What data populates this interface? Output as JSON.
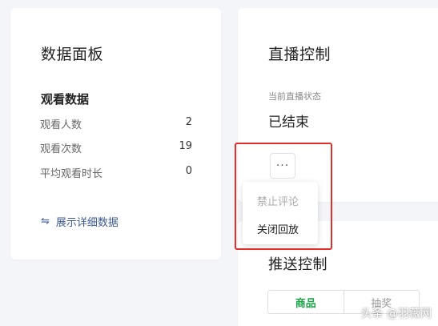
{
  "data_panel": {
    "title": "数据面板",
    "section_title": "观看数据",
    "rows": [
      {
        "label": "观看人数",
        "value": "2"
      },
      {
        "label": "观看次数",
        "value": "19"
      },
      {
        "label": "平均观看时长",
        "value": "0"
      }
    ],
    "expand_link": "展示详细数据"
  },
  "live_control": {
    "title": "直播控制",
    "status_label": "当前直播状态",
    "status_value": "已结束",
    "more_button": "···"
  },
  "dropdown_menu": {
    "items": [
      {
        "label": "禁止评论",
        "disabled": true
      },
      {
        "label": "关闭回放",
        "disabled": false
      }
    ]
  },
  "push_control": {
    "title": "推送控制",
    "tabs": [
      {
        "label": "商品",
        "active": true
      },
      {
        "label": "抽奖",
        "active": false
      }
    ]
  },
  "watermark": "头条 @羽薇网",
  "colors": {
    "accent_green": "#1da34a",
    "link_blue": "#3b5998",
    "highlight_red": "#e0302a"
  }
}
